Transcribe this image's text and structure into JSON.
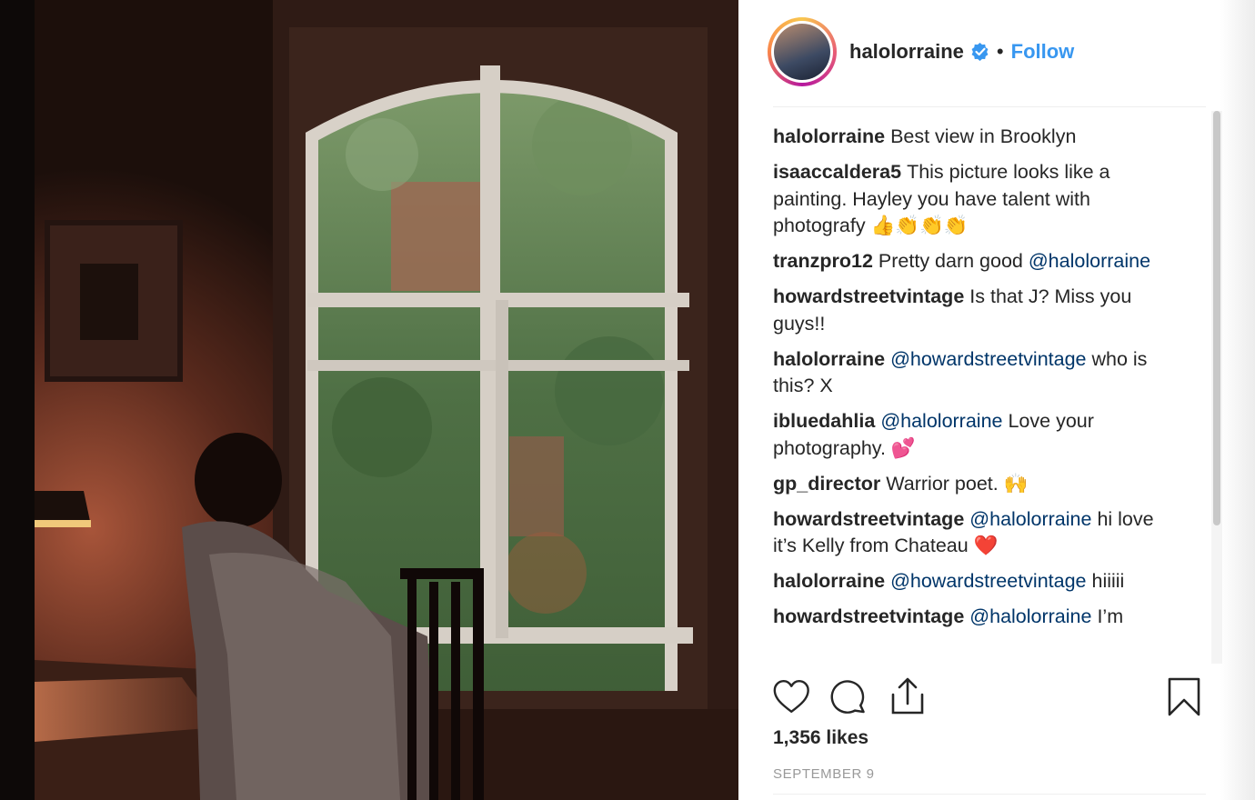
{
  "post": {
    "username": "halolorraine",
    "separator": "•",
    "follow_label": "Follow",
    "verified_icon": "verified-badge-icon",
    "accent_color": "#3897f0"
  },
  "comments": [
    {
      "user": "halolorraine",
      "parts": [
        {
          "t": "Best view in Brooklyn"
        }
      ]
    },
    {
      "user": "isaaccaldera5",
      "parts": [
        {
          "t": "This picture looks like a painting. Hayley you have talent with photografy 👍👏👏👏"
        }
      ]
    },
    {
      "user": "tranzpro12",
      "parts": [
        {
          "t": "Pretty darn good "
        },
        {
          "m": "@halolorraine"
        }
      ]
    },
    {
      "user": "howardstreetvintage",
      "parts": [
        {
          "t": "Is that J? Miss you guys!!"
        }
      ]
    },
    {
      "user": "halolorraine",
      "parts": [
        {
          "m": "@howardstreetvintage"
        },
        {
          "t": " who is this? X"
        }
      ]
    },
    {
      "user": "ibluedahlia",
      "parts": [
        {
          "m": "@halolorraine"
        },
        {
          "t": " Love your photography. 💕"
        }
      ]
    },
    {
      "user": "gp_director",
      "parts": [
        {
          "t": "Warrior poet. 🙌"
        }
      ]
    },
    {
      "user": "howardstreetvintage",
      "parts": [
        {
          "m": "@halolorraine"
        },
        {
          "t": " hi love it’s Kelly from Chateau ❤️"
        }
      ]
    },
    {
      "user": "halolorraine",
      "parts": [
        {
          "m": "@howardstreetvintage"
        },
        {
          "t": " hiiiii"
        }
      ]
    },
    {
      "user": "howardstreetvintage",
      "parts": [
        {
          "m": "@halolorraine"
        },
        {
          "t": " I’m"
        }
      ]
    }
  ],
  "actions": {
    "like": "heart-icon",
    "comment": "comment-bubble-icon",
    "share": "share-icon",
    "save": "bookmark-icon"
  },
  "likes_text": "1,356 likes",
  "date_text": "SEPTEMBER 9"
}
